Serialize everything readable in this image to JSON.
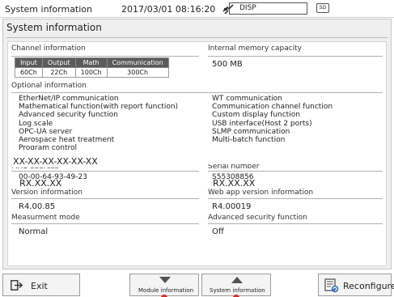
{
  "topbar": {
    "title": "System  information",
    "datetime": "2017/03/01 08:16:20",
    "disp_label": "DISP",
    "sd_label": "SD"
  },
  "panel": {
    "title": "System  information"
  },
  "channel": {
    "label": "Channel information",
    "headers": [
      "Input",
      "Output",
      "Math",
      "Communication"
    ],
    "values": [
      "60Ch",
      "22Ch",
      "100Ch",
      "300Ch"
    ]
  },
  "memory": {
    "label": "Internal memory capacity",
    "value": "500  MB"
  },
  "optional": {
    "label": "Optional  information",
    "left": [
      "EtherNet/IP  communication",
      "Mathematical  function(with  report  function)",
      "Advanced  security  function",
      "Log  scale",
      "OPC-UA  server",
      "Aerospace  heat  treatment",
      "Program  control"
    ],
    "right": [
      "WT  communication",
      "Communication  channel  function",
      "Custom  display  function",
      "USB  interface(Host  2  ports)",
      "SLMP  communication",
      "Multi-batch  function"
    ]
  },
  "mac": {
    "label": "MAC  address",
    "value": "00-00-64-93-49-23",
    "mask": "XX-XX-XX-XX-XX-XX",
    "mask2": "RX.XX.XX"
  },
  "serial": {
    "label": "Serial  number",
    "value": "S55308856",
    "mask": "RX.XX.XX"
  },
  "version": {
    "label": "Version  information",
    "value": "R4.00.85"
  },
  "webapp": {
    "label": "Web  app  version  information",
    "value": "R4.00019"
  },
  "measurement": {
    "label": "Measurment  mode",
    "value": "Normal"
  },
  "security": {
    "label": "Advanced  security  function",
    "value": "Off"
  },
  "buttons": {
    "exit": "Exit",
    "module": "Module  information",
    "system": "System  information",
    "reconfigure": "Reconfigure"
  }
}
